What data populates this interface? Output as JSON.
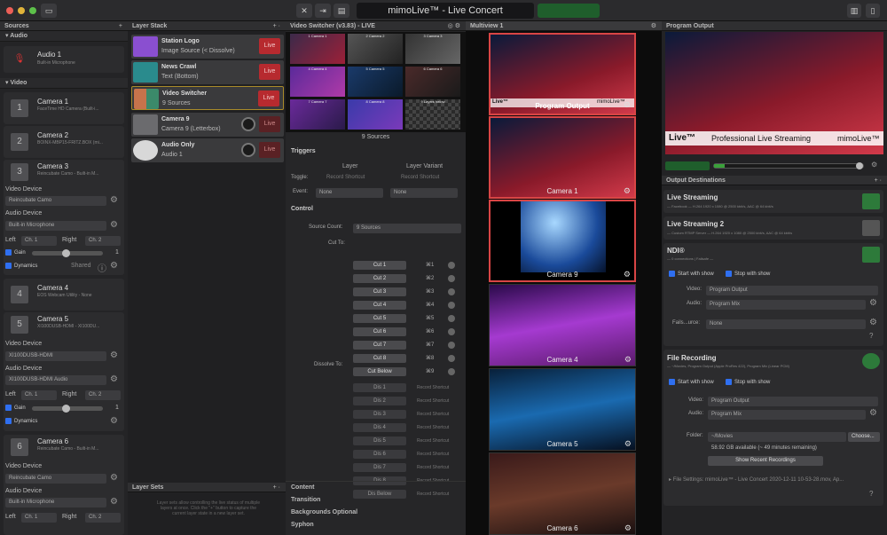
{
  "window": {
    "title": "mimoLive™ - Live Concert",
    "toolbar_live": ""
  },
  "sources": {
    "header": "Sources",
    "audio_section": "Audio",
    "video_section": "Video",
    "items": [
      {
        "name": "Audio 1",
        "sub": "Built-in Microphone",
        "icon": "mic-icon"
      },
      {
        "name": "Camera 1",
        "sub": "FaceTime HD Camera (Built-i...",
        "icon": "1"
      },
      {
        "name": "Camera 2",
        "sub": "BOINX-MBP15-FRITZ.BOX (mi...",
        "icon": "2"
      },
      {
        "name": "Camera 3",
        "sub": "Reincubate Camo - Built-in M...",
        "icon": "3"
      },
      {
        "name": "Camera 4",
        "sub": "EOS Webcam Utility - None",
        "icon": "4"
      },
      {
        "name": "Camera 5",
        "sub": "XI100DUSB-HDMI - XI100DU...",
        "icon": "5"
      },
      {
        "name": "Camera 6",
        "sub": "Reincubate Camo - Built-in M...",
        "icon": "6"
      }
    ],
    "cam3": {
      "video_device_label": "Video Device",
      "video_device": "Reincubate Camo",
      "audio_device_label": "Audio Device",
      "audio_device": "Built-in Microphone",
      "left_label": "Left",
      "left": "Ch. 1",
      "right_label": "Right",
      "right": "Ch. 2",
      "gain_label": "Gain",
      "gain_value": "1",
      "dynamics_label": "Dynamics",
      "shared": "Shared"
    },
    "cam5": {
      "video_device_label": "Video Device",
      "video_device": "XI100DUSB-HDMI",
      "audio_device_label": "Audio Device",
      "audio_device": "XI100DUSB-HDMI Audio",
      "left_label": "Left",
      "left": "Ch. 1",
      "right_label": "Right",
      "right": "Ch. 2",
      "gain_label": "Gain",
      "gain_value": "1",
      "dynamics_label": "Dynamics"
    },
    "cam6": {
      "video_device_label": "Video Device",
      "video_device": "Reincubate Camo",
      "audio_device_label": "Audio Device",
      "audio_device": "Built-in Microphone",
      "left_label": "Left",
      "left": "Ch. 1",
      "right_label": "Right",
      "right": "Ch. 2"
    }
  },
  "layer_stack": {
    "header": "Layer Stack",
    "live_label": "Live",
    "layers": [
      {
        "name": "Station Logo",
        "sub": "Image Source (< Dissolve)",
        "color": "#8a4fd0",
        "live": true
      },
      {
        "name": "News Crawl",
        "sub": "Text (Bottom)",
        "color": "#2a8b8d",
        "live": true
      },
      {
        "name": "Video Switcher",
        "sub": "9 Sources",
        "color": "#c7734b",
        "live": true
      },
      {
        "name": "Camera 9",
        "sub": "Camera 9 (Letterbox)",
        "color": "#6b6b6e",
        "live": false
      },
      {
        "name": "Audio Only",
        "sub": "Audio 1",
        "color": "#d8d8d8",
        "live": false
      }
    ],
    "layer_sets_header": "Layer Sets",
    "layer_sets_hint": "Layer sets allow controlling the live status of multiple layers at once. Click the \"+\" button to capture the current layer state in a new layer set."
  },
  "video_switcher": {
    "header": "Video Switcher (v3.83) - LIVE",
    "thumbs": [
      "1 Camera 1",
      "2 Camera 2",
      "3 Camera 3",
      "4 Camera 4",
      "5 Camera 5",
      "6 Camera 6",
      "7 Camera 7",
      "8 Camera 8",
      "9 Layers below"
    ],
    "sources_count": "9 Sources",
    "triggers": "Triggers",
    "layer_col": "Layer",
    "variant_col": "Layer Variant",
    "toggle_label": "Toggle:",
    "record_shortcut": "Record Shortcut",
    "event_label": "Event:",
    "event_value": "None",
    "control": "Control",
    "source_count_label": "Source Count:",
    "source_count_value": "9 Sources",
    "cut_to_label": "Cut To:",
    "cuts": [
      {
        "label": "Cut 1",
        "key": "⌘1"
      },
      {
        "label": "Cut 2",
        "key": "⌘2"
      },
      {
        "label": "Cut 3",
        "key": "⌘3"
      },
      {
        "label": "Cut 4",
        "key": "⌘4"
      },
      {
        "label": "Cut 5",
        "key": "⌘5"
      },
      {
        "label": "Cut 6",
        "key": "⌘6"
      },
      {
        "label": "Cut 7",
        "key": "⌘7"
      },
      {
        "label": "Cut 8",
        "key": "⌘8"
      },
      {
        "label": "Cut Below",
        "key": "⌘9"
      }
    ],
    "dissolve_to_label": "Dissolve To:",
    "dissolves": [
      "Dis 1",
      "Dis 2",
      "Dis 3",
      "Dis 4",
      "Dis 5",
      "Dis 6",
      "Dis 7",
      "Dis 8",
      "Dis Below"
    ],
    "sections": [
      "Content",
      "Transition",
      "Backgrounds Optional",
      "Syphon"
    ]
  },
  "multiview": {
    "header": "Multiview 1",
    "tiles": [
      "Program Output",
      "Camera 1",
      "Camera 9",
      "Camera 4",
      "Camera 5",
      "Camera 6"
    ],
    "tile_overlay": {
      "brand": "Live™",
      "mid": "Professional Live Streaming",
      "right": "mimoLive™"
    }
  },
  "program_output": {
    "header": "Program Output",
    "lower_third_left": "Live™",
    "lower_third_mid": "Professional Live Streaming",
    "lower_third_right": "mimoLive™",
    "volume_label": ""
  },
  "output_destinations": {
    "header": "Output Destinations",
    "live_streaming": {
      "name": "Live Streaming",
      "sub": "— Facebook                         — H.264 1920 x 1080 @ 2500 kbit/s, AAC @ 64 kbit/s"
    },
    "live_streaming2": {
      "name": "Live Streaming 2",
      "sub": "— Custom RTMP Server — H.264 1920 x 1080 @ 2500 kbit/s, AAC @ 64 kbit/s"
    },
    "ndi": {
      "name": "NDI®",
      "sub": "— 0 connections | Failsafe —",
      "start_label": "Start with show",
      "stop_label": "Stop with show",
      "video_label": "Video:",
      "video_value": "Program Output",
      "audio_label": "Audio:",
      "audio_value": "Program Mix",
      "fails_label": "Fails...urce:",
      "fails_value": "None"
    },
    "file_recording": {
      "name": "File Recording",
      "sub": "— ~/Movies, Program Output (Apple ProRes 422), Program Mix (Linear PCM)",
      "start_label": "Start with show",
      "stop_label": "Stop with show",
      "video_label": "Video:",
      "video_value": "Program Output",
      "audio_label": "Audio:",
      "audio_value": "Program Mix",
      "folder_label": "Folder:",
      "folder_value": "~/Movies",
      "choose": "Choose...",
      "available": "58.92 GB available (~ 49 minutes remaining)",
      "show_recent": "Show Recent Recordings",
      "file_settings": "File Settings: mimoLive™ - Live Concert 2020-12-11 10-53-28.mov, Ap..."
    }
  }
}
